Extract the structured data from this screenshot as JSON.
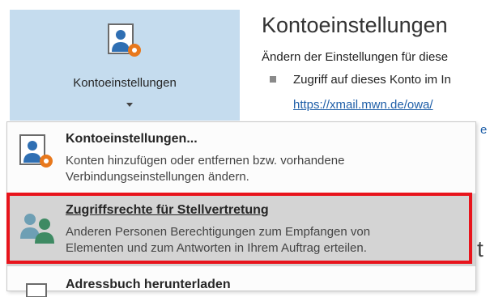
{
  "ribbon_button": {
    "label": "Kontoeinstellungen"
  },
  "right_panel": {
    "title": "Kontoeinstellungen",
    "description": "Ändern der Einstellungen für diese",
    "bullet": "Zugriff auf dieses Konto im In",
    "link": "https://xmail.mwn.de/owa/",
    "link2": "e i",
    "fragment": "t"
  },
  "menu": {
    "items": [
      {
        "title": "Kontoeinstellungen...",
        "desc_line1": "Konten hinzufügen oder entfernen bzw. vorhandene",
        "desc_line2": "Verbindungseinstellungen ändern."
      },
      {
        "title": "Zugriffsrechte für Stellvertretung",
        "desc_line1": "Anderen Personen Berechtigungen zum Empfangen von",
        "desc_line2": "Elementen und zum Antworten in Ihrem Auftrag erteilen."
      },
      {
        "title": "Adressbuch herunterladen"
      }
    ]
  },
  "colors": {
    "ribbon_selected": "#c5dcee",
    "highlight_border": "#e8141c",
    "hover_bg": "#d4d4d4",
    "link": "#1f5fa8"
  }
}
